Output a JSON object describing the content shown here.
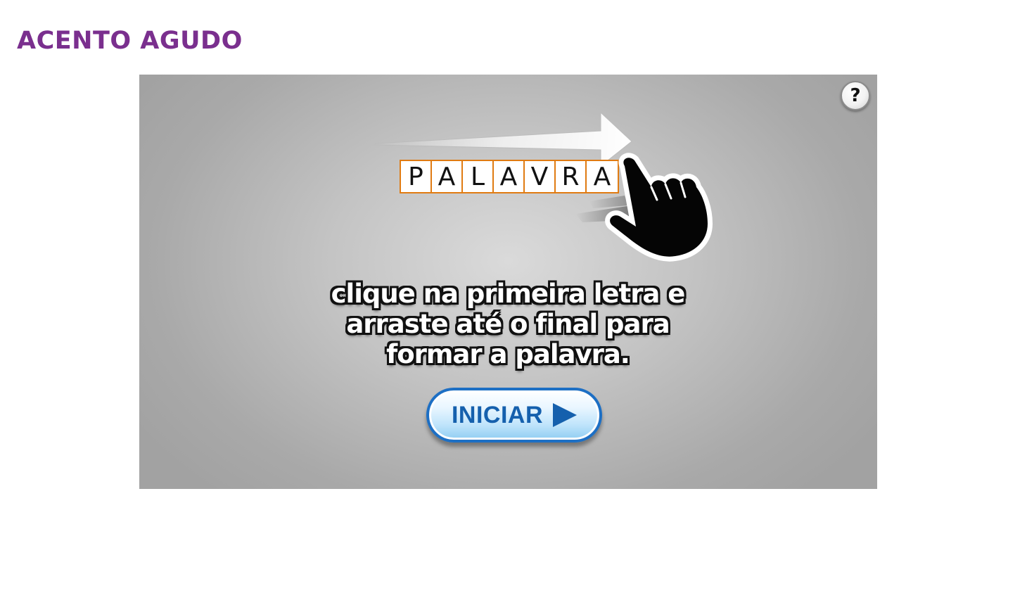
{
  "page": {
    "title": "ACENTO AGUDO",
    "title_color": "#7a2f8e"
  },
  "game": {
    "help_label": "?",
    "example_letters": [
      "P",
      "A",
      "L",
      "A",
      "V",
      "R",
      "A"
    ],
    "instructions": "clique na primeira letra e\narraste até o final para\nformar a palavra.",
    "start_label": "INICIAR",
    "icons": {
      "help": "question-mark-icon",
      "arrow": "arrow-right-icon",
      "hand": "pointing-hand-icon",
      "start": "play-triangle-icon"
    },
    "colors": {
      "letter_border": "#e07b12",
      "button_border": "#1d6fc4",
      "button_text": "#1560ad"
    }
  }
}
